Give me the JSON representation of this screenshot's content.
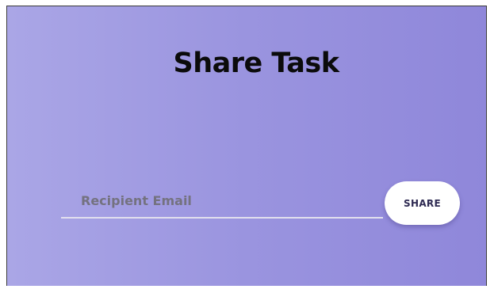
{
  "dialog": {
    "title": "Share Task",
    "email": {
      "value": "",
      "placeholder": "Recipient Email"
    },
    "share_label": "SHARE"
  },
  "colors": {
    "gradient_start": "#aaa6e6",
    "gradient_end": "#8f87da",
    "title_text": "#0b0b0b",
    "button_background": "#ffffff",
    "button_text": "#2e2a52"
  }
}
